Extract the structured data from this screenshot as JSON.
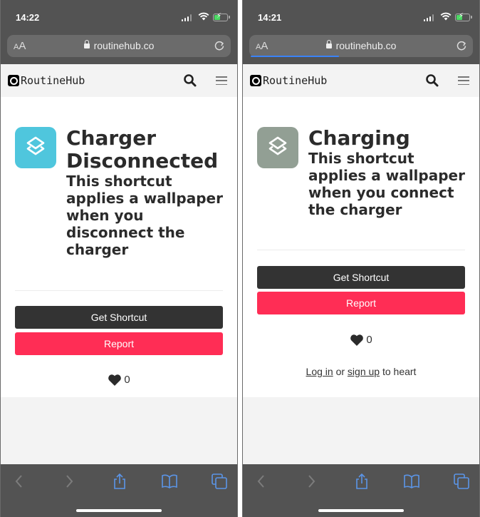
{
  "screens": [
    {
      "status": {
        "time": "14:22"
      },
      "browser": {
        "text_size_label_small": "A",
        "text_size_label_big": "A",
        "url": "routinehub.co",
        "loading": false
      },
      "site": {
        "brand": "RoutineHub"
      },
      "shortcut": {
        "title": "Charger Disconnected",
        "description": "This shortcut applies a wallpaper when you disconnect the charger",
        "icon_color": "#4fc6dd",
        "get_label": "Get Shortcut",
        "report_label": "Report",
        "hearts": "0"
      }
    },
    {
      "status": {
        "time": "14:21"
      },
      "browser": {
        "text_size_label_small": "A",
        "text_size_label_big": "A",
        "url": "routinehub.co",
        "loading": true
      },
      "site": {
        "brand": "RoutineHub"
      },
      "shortcut": {
        "title": "Charging",
        "description": "This shortcut applies a wallpaper when you connect the charger",
        "icon_color": "#929f94",
        "get_label": "Get Shortcut",
        "report_label": "Report",
        "hearts": "0",
        "login_link": "Log in",
        "or_text": " or ",
        "signup_link": "sign up",
        "to_heart_text": " to heart"
      }
    }
  ],
  "toolbar_icons": [
    "back-icon",
    "forward-icon",
    "share-icon",
    "bookmarks-icon",
    "tabs-icon"
  ],
  "colors": {
    "accent_red": "#ff2d55",
    "dark_button": "#333333",
    "ios_blue": "#4a90e2"
  }
}
